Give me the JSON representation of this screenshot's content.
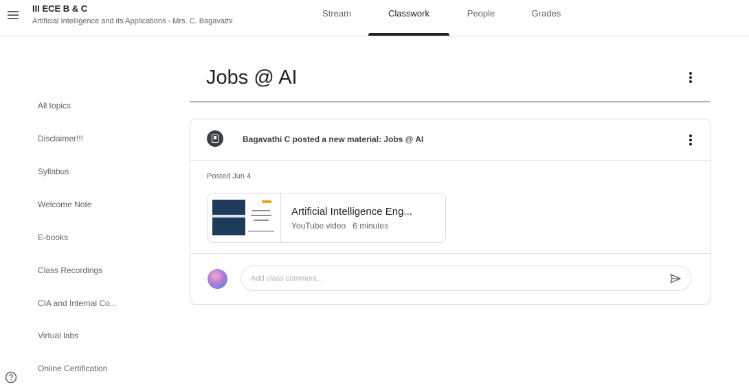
{
  "header": {
    "class_title": "III ECE B & C",
    "class_subtitle": "Artificial Intelligence and its Applications - Mrs. C. Bagavathi",
    "tabs": [
      {
        "label": "Stream",
        "active": false
      },
      {
        "label": "Classwork",
        "active": true
      },
      {
        "label": "People",
        "active": false
      },
      {
        "label": "Grades",
        "active": false
      }
    ]
  },
  "sidebar": {
    "topics": [
      {
        "label": "All topics"
      },
      {
        "label": "Disclaimer!!!"
      },
      {
        "label": "Syllabus"
      },
      {
        "label": "Welcome Note"
      },
      {
        "label": "E-books"
      },
      {
        "label": "Class Recordings"
      },
      {
        "label": "CIA and Internal Co..."
      },
      {
        "label": "Virtual labs"
      },
      {
        "label": "Online Certification"
      }
    ]
  },
  "main": {
    "page_title": "Jobs @ AI",
    "post": {
      "author_line": "Bagavathi C posted a new material: Jobs @ AI",
      "posted_date": "Posted Jun 4",
      "attachment": {
        "title": "Artificial Intelligence Eng...",
        "meta": "YouTube video   6 minutes"
      },
      "comment_placeholder": "Add class comment..."
    }
  },
  "icons": {
    "menu": "menu-icon",
    "help": "help-icon",
    "more": "more-vert-icon",
    "material": "material-icon",
    "send": "send-icon"
  },
  "colors": {
    "accent": "#202124",
    "text_secondary": "#5f6368",
    "border": "#dadce0"
  }
}
